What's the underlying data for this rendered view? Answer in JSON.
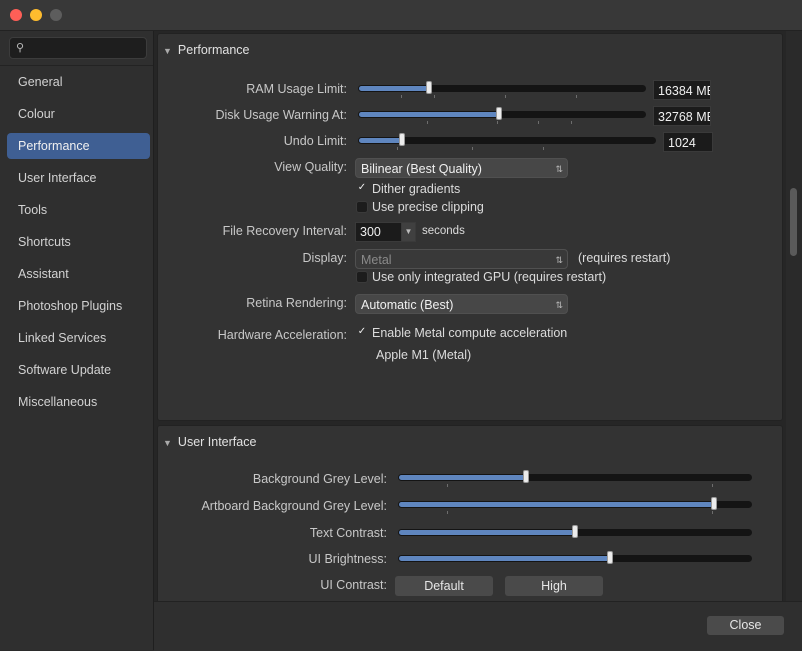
{
  "window": {
    "colors": {
      "close": "#fe5f57",
      "minimize": "#febc2e",
      "zoom": "#5d5d5d",
      "accent": "#5f86bf"
    }
  },
  "search": {
    "icon": "search-icon",
    "placeholder": ""
  },
  "sidebar": {
    "items": [
      {
        "label": "General"
      },
      {
        "label": "Colour"
      },
      {
        "label": "Performance",
        "active": true
      },
      {
        "label": "User Interface"
      },
      {
        "label": "Tools"
      },
      {
        "label": "Shortcuts"
      },
      {
        "label": "Assistant"
      },
      {
        "label": "Photoshop Plugins"
      },
      {
        "label": "Linked Services"
      },
      {
        "label": "Software Update"
      },
      {
        "label": "Miscellaneous"
      }
    ]
  },
  "performance": {
    "title": "Performance",
    "ram": {
      "label": "RAM Usage Limit:",
      "value": "16384 MB",
      "level": 0.24
    },
    "disk": {
      "label": "Disk Usage Warning At:",
      "value": "32768 MB",
      "level": 0.49
    },
    "undo": {
      "label": "Undo Limit:",
      "value": "1024",
      "level": 0.14
    },
    "view_quality": {
      "label": "View Quality:",
      "value": "Bilinear (Best Quality)"
    },
    "dither": {
      "label": "Dither gradients",
      "checked": true
    },
    "precise": {
      "label": "Use precise clipping",
      "checked": false
    },
    "recovery": {
      "label": "File Recovery Interval:",
      "value": "300",
      "unit": "seconds"
    },
    "display": {
      "label": "Display:",
      "value": "Metal",
      "note": "(requires restart)"
    },
    "integrated_gpu": {
      "label": "Use only integrated GPU (requires restart)",
      "checked": false
    },
    "retina": {
      "label": "Retina Rendering:",
      "value": "Automatic (Best)"
    },
    "hw": {
      "label": "Hardware Acceleration:",
      "option": "Enable Metal compute acceleration",
      "checked": true,
      "device": "Apple M1 (Metal)"
    }
  },
  "ui": {
    "title": "User Interface",
    "bg_grey": {
      "label": "Background Grey Level:",
      "level": 0.36
    },
    "artboard_grey": {
      "label": "Artboard Background Grey Level:",
      "level": 0.9
    },
    "text_contrast": {
      "label": "Text Contrast:",
      "level": 0.5
    },
    "brightness": {
      "label": "UI Brightness:",
      "level": 0.6
    },
    "contrast": {
      "label": "UI Contrast:",
      "options": [
        "Default",
        "High"
      ]
    }
  },
  "footer": {
    "close_label": "Close"
  }
}
